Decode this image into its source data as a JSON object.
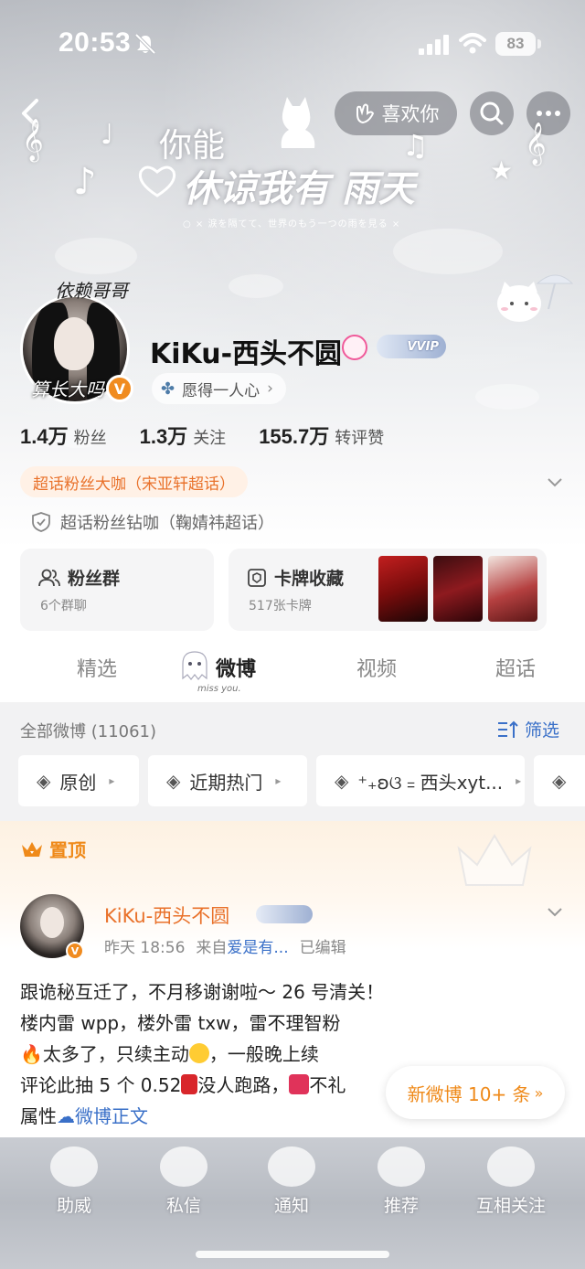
{
  "status_bar": {
    "time": "20:53",
    "battery": "83"
  },
  "banner": {
    "like_label": "喜欢你",
    "line1": "你能",
    "line2": "休谅我有 雨天",
    "subtitle": "○ × 涙を隔てて、世界のもう一つの雨を見る ×"
  },
  "profile": {
    "avatar_top_text": "依赖哥哥",
    "avatar_bottom_text": "算长大吗",
    "verified_mark": "V",
    "name": "KiKu-西头不圆",
    "vip_label": "VVIP",
    "motto": "愿得一人心",
    "stats": [
      {
        "value": "1.4万",
        "label": "粉丝"
      },
      {
        "value": "1.3万",
        "label": "关注"
      },
      {
        "value": "155.7万",
        "label": "转评赞"
      }
    ],
    "badge_primary": "超话粉丝大咖（宋亚轩超话）",
    "badge_secondary": "超话粉丝钻咖（鞠婧祎超话）"
  },
  "cards": {
    "fans_group": {
      "title": "粉丝群",
      "sub": "6个群聊"
    },
    "card_collection": {
      "title": "卡牌收藏",
      "sub": "517张卡牌"
    }
  },
  "tabs": [
    {
      "label": "精选",
      "active": false
    },
    {
      "label": "微博",
      "active": true
    },
    {
      "label": "视频",
      "active": false
    },
    {
      "label": "超话",
      "active": false
    }
  ],
  "tab_deco": "miss you.",
  "feed": {
    "all_label": "全部微博 (11061)",
    "filter_label": "筛选",
    "chips": [
      "原创",
      "近期热门",
      "⁺₊ʚଓ﹦西头xyt..."
    ]
  },
  "pinned": {
    "label": "置顶",
    "author": "KiKu-西头不圆",
    "time": "昨天 18:56",
    "source_prefix": "来自",
    "source": "爱是有...",
    "edited": "已编辑",
    "lines": {
      "l1": "跟诡秘互迁了，不月移谢谢啦～ 26 号清关！",
      "l2": "楼内雷 wpp，楼外雷 txw，雷不理智粉",
      "l3a": "太多了，只续主动",
      "l3b": "，一般晚上续",
      "l4a": "评论此抽 5 个 0.52",
      "l4b": "没人跑路，",
      "l4c": "不礼",
      "l5a": "属性",
      "l5b": "微博正文"
    },
    "new_posts": "新微博 10+ 条"
  },
  "bottom_nav": [
    "助威",
    "私信",
    "通知",
    "推荐",
    "互相关注"
  ],
  "colors": {
    "accent_orange": "#ef8a1a",
    "link_blue": "#3a70c8"
  }
}
